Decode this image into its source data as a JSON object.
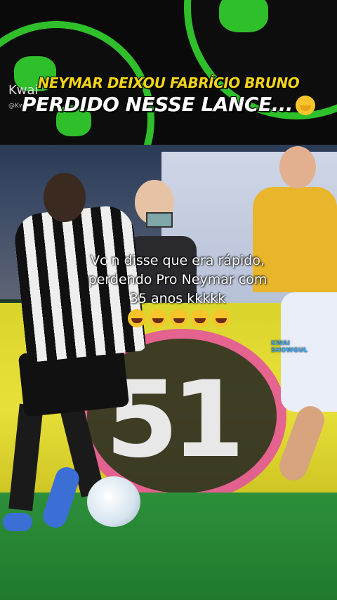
{
  "banner": {
    "line1": "NEYMAR DEIXOU FABRÍCIO BRUNO",
    "line2": "PERDIDO NESSE LANCE...",
    "emoji": "face-with-hand-over-mouth",
    "watermark": "Kwai",
    "watermark_user": "@Kwai..."
  },
  "video": {
    "overlay_text": "Vc n disse que era rápido, perdendo Pro Neymar com 35 anos kkkkk",
    "overlay_emoji_count": 5,
    "overlay_emoji": "rolling-on-floor-laughing",
    "board_number": "51",
    "kwai_badge_line1": "KWAI",
    "kwai_badge_line2": "SHOWGUL",
    "colors": {
      "banner_green": "#2fbf2a",
      "headline_yellow": "#f2d31a",
      "board_yellow": "#e8e03a",
      "board_pink": "#e64fa0"
    }
  }
}
